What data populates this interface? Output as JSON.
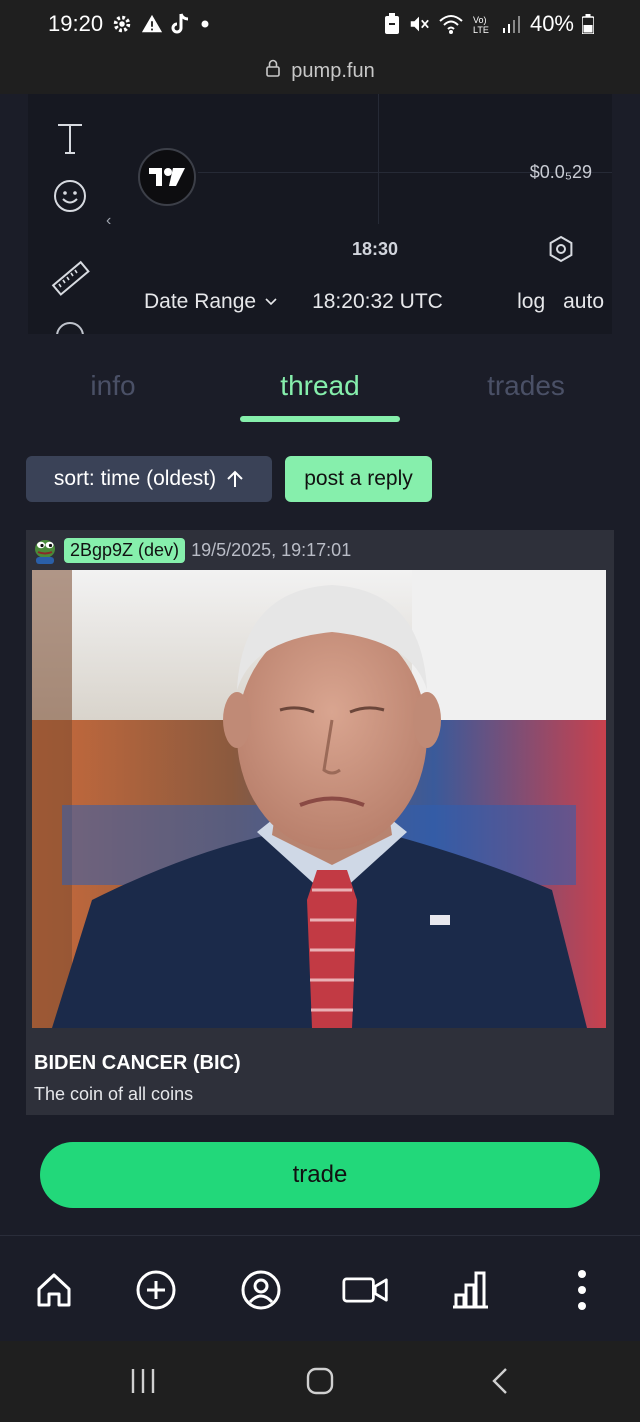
{
  "status_bar": {
    "time": "19:20",
    "battery": "40%"
  },
  "url_bar": {
    "url": "pump.fun"
  },
  "chart": {
    "price_label": "$0.0₅29",
    "time_label": "18:30",
    "date_range_label": "Date Range",
    "utc_time": "18:20:32 UTC",
    "log_label": "log",
    "auto_label": "auto"
  },
  "tabs": [
    {
      "label": "info",
      "active": false
    },
    {
      "label": "thread",
      "active": true
    },
    {
      "label": "trades",
      "active": false
    }
  ],
  "thread": {
    "sort_label": "sort: time (oldest)",
    "reply_label": "post a reply",
    "post": {
      "user": "2Bgp9Z (dev)",
      "timestamp": "19/5/2025, 19:17:01",
      "title": "BIDEN CANCER (BIC)",
      "description": "The coin of all coins"
    }
  },
  "trade_button": {
    "label": "trade"
  },
  "bottom_nav": [
    {
      "icon": "home-icon"
    },
    {
      "icon": "plus-circle-icon"
    },
    {
      "icon": "profile-icon"
    },
    {
      "icon": "video-icon"
    },
    {
      "icon": "bar-chart-icon"
    },
    {
      "icon": "more-vertical-icon"
    }
  ],
  "colors": {
    "accent": "#86efac",
    "trade": "#22d87a",
    "background": "#1b1d28"
  }
}
